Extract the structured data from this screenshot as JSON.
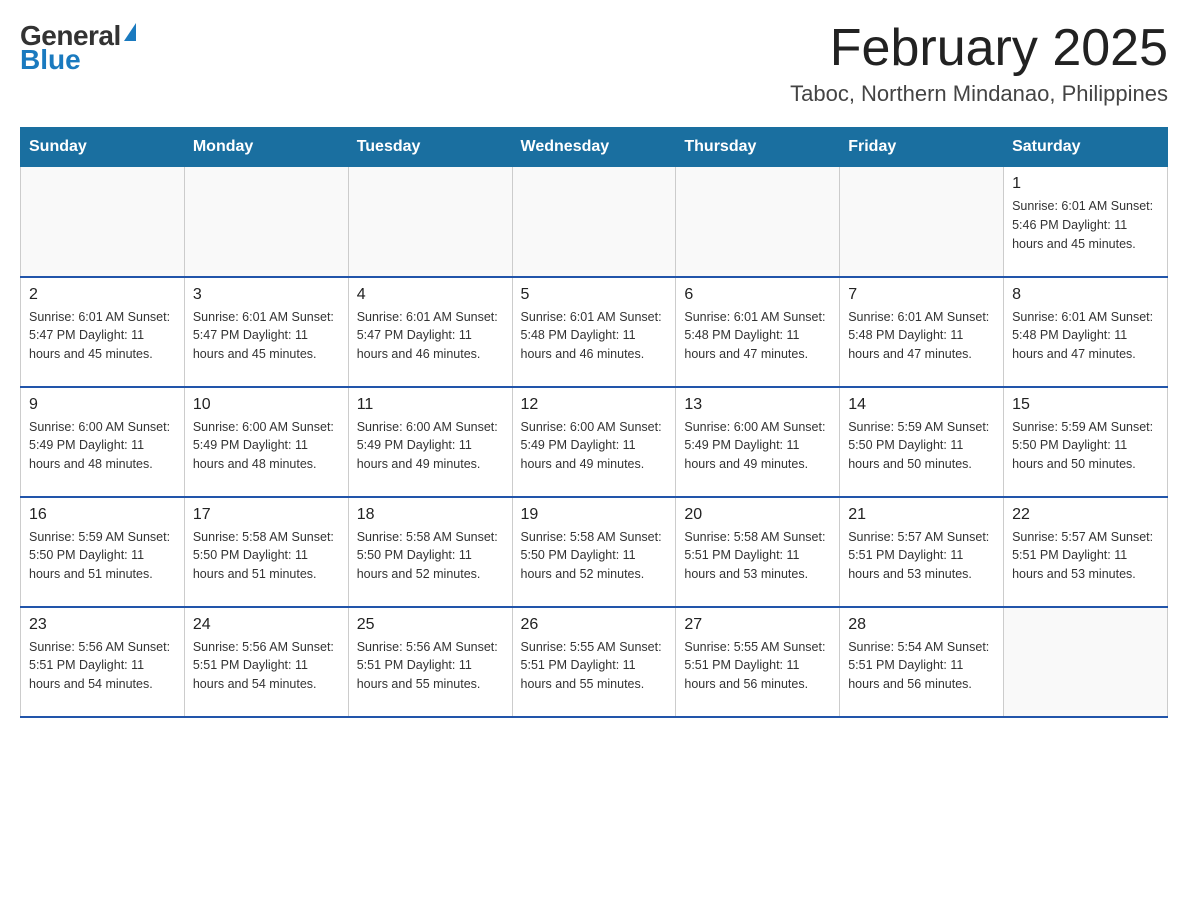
{
  "logo": {
    "general": "General",
    "blue": "Blue"
  },
  "header": {
    "title": "February 2025",
    "subtitle": "Taboc, Northern Mindanao, Philippines"
  },
  "weekdays": [
    "Sunday",
    "Monday",
    "Tuesday",
    "Wednesday",
    "Thursday",
    "Friday",
    "Saturday"
  ],
  "weeks": [
    [
      {
        "day": "",
        "info": ""
      },
      {
        "day": "",
        "info": ""
      },
      {
        "day": "",
        "info": ""
      },
      {
        "day": "",
        "info": ""
      },
      {
        "day": "",
        "info": ""
      },
      {
        "day": "",
        "info": ""
      },
      {
        "day": "1",
        "info": "Sunrise: 6:01 AM\nSunset: 5:46 PM\nDaylight: 11 hours\nand 45 minutes."
      }
    ],
    [
      {
        "day": "2",
        "info": "Sunrise: 6:01 AM\nSunset: 5:47 PM\nDaylight: 11 hours\nand 45 minutes."
      },
      {
        "day": "3",
        "info": "Sunrise: 6:01 AM\nSunset: 5:47 PM\nDaylight: 11 hours\nand 45 minutes."
      },
      {
        "day": "4",
        "info": "Sunrise: 6:01 AM\nSunset: 5:47 PM\nDaylight: 11 hours\nand 46 minutes."
      },
      {
        "day": "5",
        "info": "Sunrise: 6:01 AM\nSunset: 5:48 PM\nDaylight: 11 hours\nand 46 minutes."
      },
      {
        "day": "6",
        "info": "Sunrise: 6:01 AM\nSunset: 5:48 PM\nDaylight: 11 hours\nand 47 minutes."
      },
      {
        "day": "7",
        "info": "Sunrise: 6:01 AM\nSunset: 5:48 PM\nDaylight: 11 hours\nand 47 minutes."
      },
      {
        "day": "8",
        "info": "Sunrise: 6:01 AM\nSunset: 5:48 PM\nDaylight: 11 hours\nand 47 minutes."
      }
    ],
    [
      {
        "day": "9",
        "info": "Sunrise: 6:00 AM\nSunset: 5:49 PM\nDaylight: 11 hours\nand 48 minutes."
      },
      {
        "day": "10",
        "info": "Sunrise: 6:00 AM\nSunset: 5:49 PM\nDaylight: 11 hours\nand 48 minutes."
      },
      {
        "day": "11",
        "info": "Sunrise: 6:00 AM\nSunset: 5:49 PM\nDaylight: 11 hours\nand 49 minutes."
      },
      {
        "day": "12",
        "info": "Sunrise: 6:00 AM\nSunset: 5:49 PM\nDaylight: 11 hours\nand 49 minutes."
      },
      {
        "day": "13",
        "info": "Sunrise: 6:00 AM\nSunset: 5:49 PM\nDaylight: 11 hours\nand 49 minutes."
      },
      {
        "day": "14",
        "info": "Sunrise: 5:59 AM\nSunset: 5:50 PM\nDaylight: 11 hours\nand 50 minutes."
      },
      {
        "day": "15",
        "info": "Sunrise: 5:59 AM\nSunset: 5:50 PM\nDaylight: 11 hours\nand 50 minutes."
      }
    ],
    [
      {
        "day": "16",
        "info": "Sunrise: 5:59 AM\nSunset: 5:50 PM\nDaylight: 11 hours\nand 51 minutes."
      },
      {
        "day": "17",
        "info": "Sunrise: 5:58 AM\nSunset: 5:50 PM\nDaylight: 11 hours\nand 51 minutes."
      },
      {
        "day": "18",
        "info": "Sunrise: 5:58 AM\nSunset: 5:50 PM\nDaylight: 11 hours\nand 52 minutes."
      },
      {
        "day": "19",
        "info": "Sunrise: 5:58 AM\nSunset: 5:50 PM\nDaylight: 11 hours\nand 52 minutes."
      },
      {
        "day": "20",
        "info": "Sunrise: 5:58 AM\nSunset: 5:51 PM\nDaylight: 11 hours\nand 53 minutes."
      },
      {
        "day": "21",
        "info": "Sunrise: 5:57 AM\nSunset: 5:51 PM\nDaylight: 11 hours\nand 53 minutes."
      },
      {
        "day": "22",
        "info": "Sunrise: 5:57 AM\nSunset: 5:51 PM\nDaylight: 11 hours\nand 53 minutes."
      }
    ],
    [
      {
        "day": "23",
        "info": "Sunrise: 5:56 AM\nSunset: 5:51 PM\nDaylight: 11 hours\nand 54 minutes."
      },
      {
        "day": "24",
        "info": "Sunrise: 5:56 AM\nSunset: 5:51 PM\nDaylight: 11 hours\nand 54 minutes."
      },
      {
        "day": "25",
        "info": "Sunrise: 5:56 AM\nSunset: 5:51 PM\nDaylight: 11 hours\nand 55 minutes."
      },
      {
        "day": "26",
        "info": "Sunrise: 5:55 AM\nSunset: 5:51 PM\nDaylight: 11 hours\nand 55 minutes."
      },
      {
        "day": "27",
        "info": "Sunrise: 5:55 AM\nSunset: 5:51 PM\nDaylight: 11 hours\nand 56 minutes."
      },
      {
        "day": "28",
        "info": "Sunrise: 5:54 AM\nSunset: 5:51 PM\nDaylight: 11 hours\nand 56 minutes."
      },
      {
        "day": "",
        "info": ""
      }
    ]
  ]
}
